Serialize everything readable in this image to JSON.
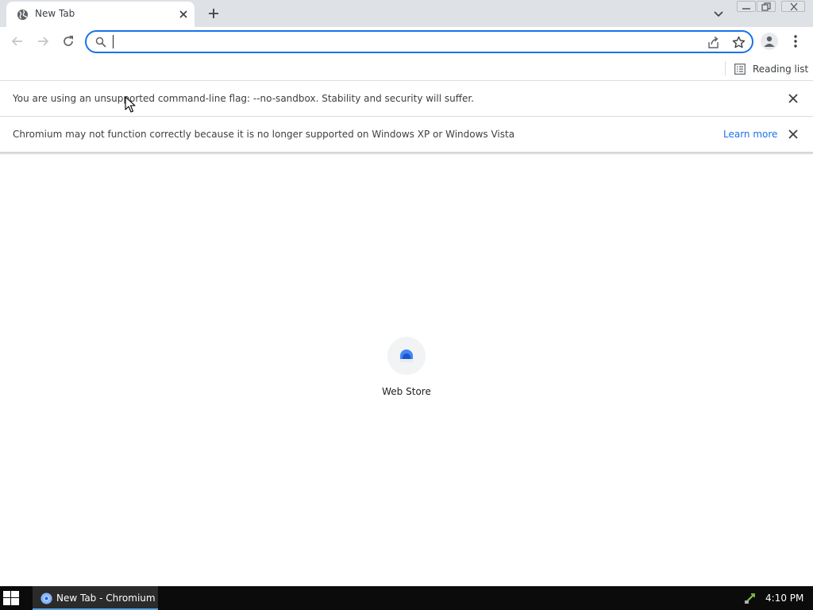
{
  "browser": {
    "tab": {
      "title": "New Tab",
      "favicon": "globe-icon"
    },
    "window_controls": [
      "minimize",
      "restore",
      "close"
    ]
  },
  "toolbar": {
    "back": "back-arrow-icon",
    "forward": "forward-arrow-icon",
    "reload": "reload-icon",
    "omnibox": {
      "value": "",
      "placeholder": ""
    }
  },
  "bookmarks_bar": {
    "reading_list_label": "Reading list"
  },
  "infobars": [
    {
      "text": "You are using an unsupported command-line flag: --no-sandbox. Stability and security will suffer."
    },
    {
      "text": "Chromium may not function correctly because it is no longer supported on Windows XP or Windows Vista",
      "link": "Learn more"
    }
  ],
  "ntp": {
    "shortcuts": [
      {
        "label": "Web Store"
      }
    ]
  },
  "taskbar": {
    "task_label": "New Tab - Chromium",
    "clock": "4:10 PM"
  },
  "colors": {
    "accent": "#1a73e8",
    "tabstrip": "#dee1e6",
    "taskbar": "#0b0b0b"
  }
}
